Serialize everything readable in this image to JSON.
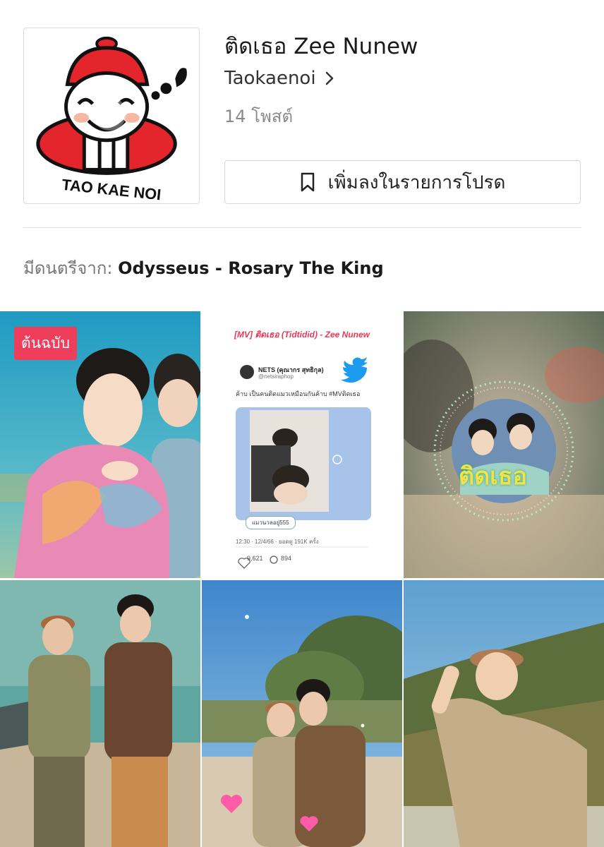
{
  "header": {
    "title": "ติดเธอ Zee Nunew",
    "creator": "Taokaenoi",
    "post_count": "14 โพสต์",
    "favorite_button": "เพิ่มลงในรายการโปรด",
    "logo_text": "TAO KAE NOI"
  },
  "music": {
    "prefix": "มีดนตรีจาก:",
    "track": "Odysseus - Rosary The King"
  },
  "grid": {
    "tiles": [
      {
        "badge": "ต้นฉบับ"
      },
      {
        "headline": "[MV] ติดเธอ (Tidtidid) - Zee Nunew",
        "tweet_name": "NETS (คุณากร สุทธิกุล)",
        "tweet_handle": "@netsiraphop",
        "tweet_text": "ค้าบ เป็นคนติดแมวเหมือนกันค้าบ #MVติดเธอ",
        "tweet_reply": "แมวนวลอยู่555",
        "tweet_meta": "12:30 · 12/4/66 · ยอดดู 191K ครั้ง",
        "tweet_likes": "9,621",
        "tweet_comments": "894"
      },
      {
        "overlay_text": "ติดเธอ"
      },
      {},
      {},
      {}
    ]
  },
  "colors": {
    "badge": "#ef3d5c",
    "logo_red": "#e4252b",
    "twitter_blue": "#1d9bf0"
  }
}
